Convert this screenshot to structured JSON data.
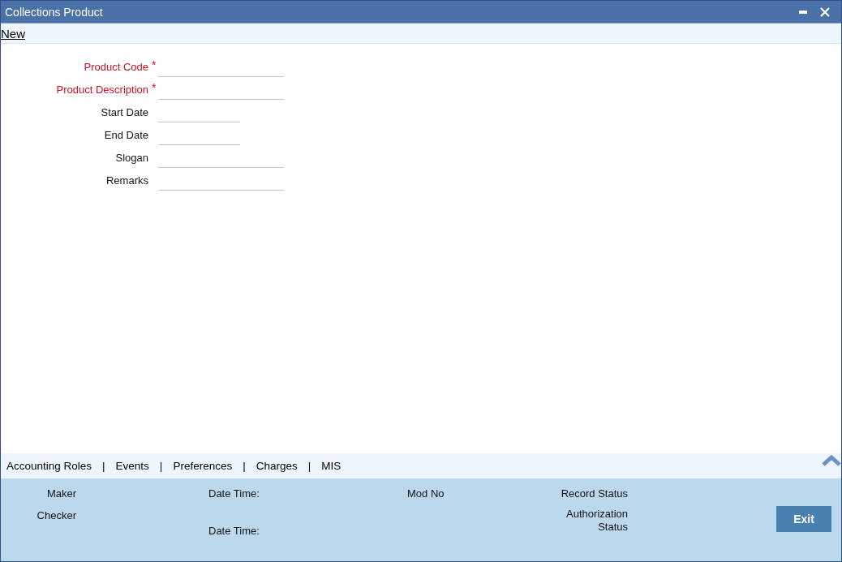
{
  "window": {
    "title": "Collections Product"
  },
  "toolbar": {
    "action": "New"
  },
  "fields": [
    {
      "label": "Product Code",
      "required": true,
      "kind": "text"
    },
    {
      "label": "Product Description",
      "required": true,
      "kind": "text"
    },
    {
      "label": "Start Date",
      "required": false,
      "kind": "date"
    },
    {
      "label": "End Date",
      "required": false,
      "kind": "date"
    },
    {
      "label": "Slogan",
      "required": false,
      "kind": "text"
    },
    {
      "label": "Remarks",
      "required": false,
      "kind": "text"
    }
  ],
  "required_mark": "*",
  "tabs": [
    "Accounting Roles",
    "Events",
    "Preferences",
    "Charges",
    "MIS"
  ],
  "tab_separator": "|",
  "audit": {
    "maker": "Maker",
    "maker_date_time": "Date Time:",
    "mod_no": "Mod No",
    "record_status": "Record Status",
    "checker": "Checker",
    "checker_date_time": "Date Time:",
    "authorization_status": "Authorization Status"
  },
  "buttons": [
    "Exit"
  ]
}
